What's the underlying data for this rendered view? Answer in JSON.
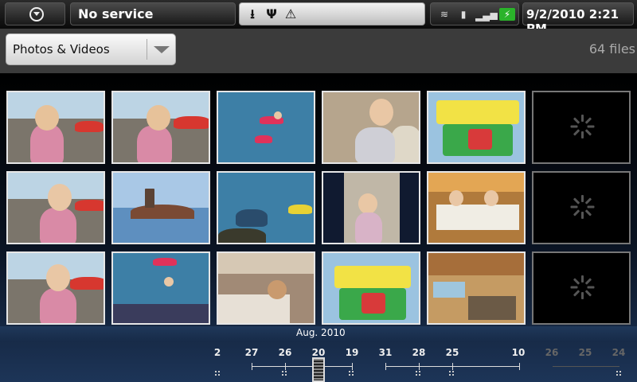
{
  "status_bar": {
    "carrier": "No service",
    "datetime": "9/2/2010 2:21 PM",
    "notification_icons": [
      "download-icon",
      "usb-icon",
      "warning-icon"
    ],
    "system_icons": [
      "wifi-icon",
      "sim-icon",
      "signal-icon",
      "battery-charging-icon"
    ]
  },
  "header": {
    "media_selector": "Photos & Videos",
    "file_count": "64 files"
  },
  "grid": {
    "loading_tiles": 3
  },
  "timeline": {
    "month": "Aug. 2010",
    "ticks": [
      "2",
      "27",
      "26",
      "20",
      "19",
      "31",
      "28",
      "25",
      "10",
      "26",
      "25",
      "24"
    ]
  },
  "colors": {
    "accent": "#2ab32a",
    "background_top": "#000000",
    "background_bottom": "#1d3558"
  }
}
